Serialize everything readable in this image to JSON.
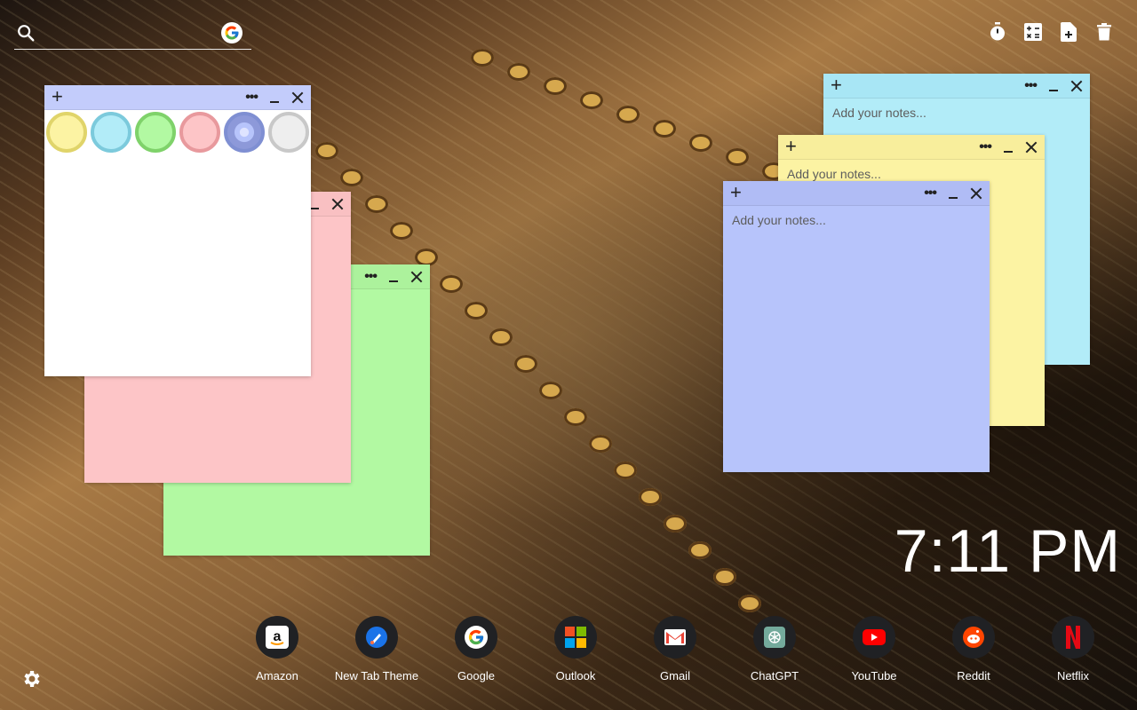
{
  "search": {
    "value": "",
    "placeholder": ""
  },
  "toolbar": {
    "icons": [
      "timer-icon",
      "calculator-icon",
      "add-note-icon",
      "trash-icon"
    ]
  },
  "notes": [
    {
      "id": "cyan",
      "color": "#b2ecf8",
      "header_color": "#a8e6f5",
      "placeholder": "Add your notes..."
    },
    {
      "id": "yellow",
      "color": "#fcf3a3",
      "header_color": "#f8ee9c",
      "placeholder": "Add your notes..."
    },
    {
      "id": "periwinkle",
      "color": "#b7c4fb",
      "header_color": "#b0bcf5",
      "placeholder": "Add your notes..."
    },
    {
      "id": "green",
      "color": "#b2f9a2",
      "header_color": "#acf29c",
      "placeholder": ""
    },
    {
      "id": "pink",
      "color": "#fdc5c7",
      "header_color": "#f9c0c2",
      "placeholder": ""
    },
    {
      "id": "white",
      "color": "#ffffff",
      "header_color": "#c3ccfb",
      "placeholder": ""
    }
  ],
  "color_palette": [
    "#fcf3a3",
    "#b2ecf8",
    "#b2f9a2",
    "#fdc5c7",
    "#b7c4fb",
    "#eeeeee"
  ],
  "clock": {
    "time": "7:11 PM"
  },
  "shortcuts": [
    {
      "label": "Amazon",
      "icon": "amazon-icon"
    },
    {
      "label": "New Tab Theme",
      "icon": "new-tab-theme-icon"
    },
    {
      "label": "Google",
      "icon": "google-icon"
    },
    {
      "label": "Outlook",
      "icon": "outlook-icon"
    },
    {
      "label": "Gmail",
      "icon": "gmail-icon"
    },
    {
      "label": "ChatGPT",
      "icon": "chatgpt-icon"
    },
    {
      "label": "YouTube",
      "icon": "youtube-icon"
    },
    {
      "label": "Reddit",
      "icon": "reddit-icon"
    },
    {
      "label": "Netflix",
      "icon": "netflix-icon"
    }
  ]
}
